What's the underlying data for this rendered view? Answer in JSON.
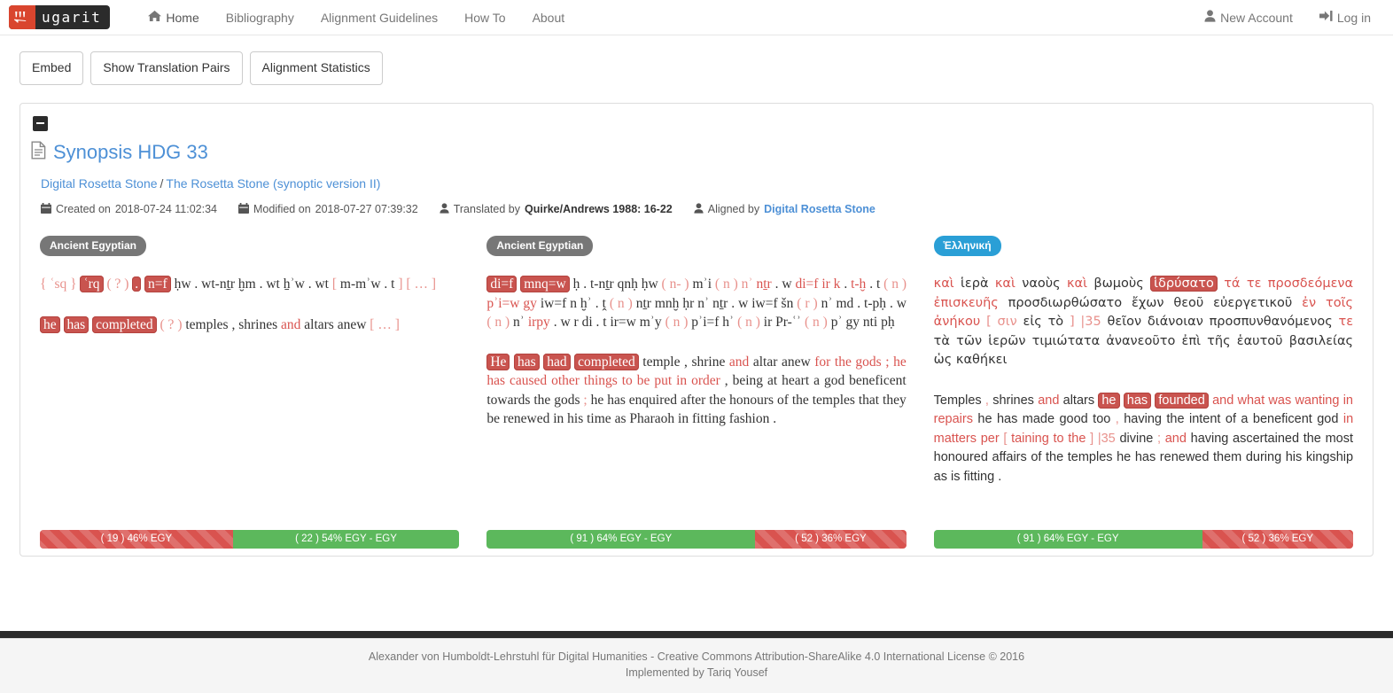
{
  "brand": {
    "text": "ugarit",
    "icon": "cuneiform-icon"
  },
  "nav": {
    "items": [
      {
        "label": "Home",
        "icon": "home-icon",
        "active": true
      },
      {
        "label": "Bibliography",
        "icon": "",
        "active": false
      },
      {
        "label": "Alignment Guidelines",
        "icon": "",
        "active": false
      },
      {
        "label": "How To",
        "icon": "",
        "active": false
      },
      {
        "label": "About",
        "icon": "",
        "active": false
      }
    ],
    "right": [
      {
        "label": "New Account",
        "icon": "user-icon"
      },
      {
        "label": "Log in",
        "icon": "login-icon"
      }
    ]
  },
  "toolbar": {
    "embed_label": "Embed",
    "pairs_label": "Show Translation Pairs",
    "stats_label": "Alignment Statistics"
  },
  "document": {
    "collapse_icon": "minus-icon",
    "file_icon": "file-text-icon",
    "title": "Synopsis HDG 33",
    "breadcrumb": {
      "parent": "Digital Rosetta Stone",
      "separator": "/",
      "child": "The Rosetta Stone (synoptic version II)"
    },
    "meta": {
      "created_icon": "calendar-icon",
      "created_label": "Created on",
      "created_value": "2018-07-24 11:02:34",
      "modified_icon": "calendar-icon",
      "modified_label": "Modified on",
      "modified_value": "2018-07-27 07:39:32",
      "translated_icon": "user-icon",
      "translated_label": "Translated by",
      "translated_value": "Quirke/Andrews 1988: 16-22",
      "aligned_icon": "user-icon",
      "aligned_label": "Aligned by",
      "aligned_value": "Digital Rosetta Stone"
    }
  },
  "columns": [
    {
      "badge": "Ancient Egyptian",
      "badge_color": "#777777",
      "segments": [
        "{ ʿsq } ʿrq ( ? ) . n=f ḥw . wt-nṯr ḫm . wt ẖʾw . wt [ m-mʾw . t ] [ … ]",
        "he has completed ( ? ) temples , shrines and altars anew [ … ]"
      ],
      "bar": [
        {
          "label": "( 19 ) 46% EGY",
          "percent": 46,
          "style": "danger"
        },
        {
          "label": "( 22 ) 54% EGY - EGY",
          "percent": 54,
          "style": "success"
        }
      ]
    },
    {
      "badge": "Ancient Egyptian",
      "badge_color": "#777777",
      "segments": [
        "di=f mnq=w ḥ . t-nṯr qnḥ ḥw ( n- ) mʾi ( n ) nʾ nṯr . w di=f ir k . t-ḫ . t ( n ) pʾi=w gy iw=f n ḫʾ . ṱ ( n ) nṯr mnḫ ḥr nʾ nṯr . w iw=f šn ( r ) nʾ md . t-pḥ . w ( n ) nʾ irpy . w r di . t ir=w mʾy ( n ) pʾi=f hʾ ( n ) ir Pr-ʿʾ ( n ) pʾ gy nti pḥ",
        "He has had completed temple , shrine and altar anew for the gods ; he has caused other things to be put in order , being at heart a god beneficent towards the gods ; he has enquired after the honours of the temples that they be renewed in his time as Pharaoh in fitting fashion ."
      ],
      "bar": [
        {
          "label": "( 91 ) 64% EGY - EGY",
          "percent": 64,
          "style": "success"
        },
        {
          "label": "( 52 ) 36% EGY",
          "percent": 36,
          "style": "danger"
        }
      ]
    },
    {
      "badge": "Ἑλληνική",
      "badge_color": "#2a9fd6",
      "segments": [
        "καὶ ἱερὰ καὶ ναοὺς καὶ βωμοὺς ἱδρύσατο τά τε προσδεόμενα ἐπισκευῆς προσδιωρθώσατο ἔχων θεοῦ εὐεργετικοῦ ἐν τοῖς ἀνήκου [ σιν εἰς τὸ ] |35 θεῖον διάνοιαν προσπυνθανόμενός τε τὰ τῶν ἱερῶν τιμιώτατα ἀνανεοῦτο ἐπὶ τῆς ἑαυτοῦ βασιλείας ὡς καθήκει",
        "Temples , shrines and altars he has founded and what was wanting in repairs he has made good too , having the intent of a beneficent god in matters per [ taining to the ] |35 divine ; and having ascertained the most honoured affairs of the temples he has renewed them during his kingship as is fitting ."
      ],
      "bar": [
        {
          "label": "( 91 ) 64% EGY - EGY",
          "percent": 64,
          "style": "success"
        },
        {
          "label": "( 52 ) 36% EGY",
          "percent": 36,
          "style": "danger"
        }
      ]
    }
  ],
  "footer": {
    "line1": "Alexander von Humboldt-Lehrstuhl für Digital Humanities - Creative Commons Attribution-ShareAlike 4.0 International License © 2016",
    "line2": "Implemented by Tariq Yousef"
  },
  "colors": {
    "accent_red": "#d9534f",
    "highlight_chip": "#c9544f",
    "link_blue": "#4d90d6",
    "badge_blue": "#2a9fd6",
    "badge_grey": "#777777",
    "success_green": "#5cb85c",
    "brand_red": "#d9452e"
  }
}
